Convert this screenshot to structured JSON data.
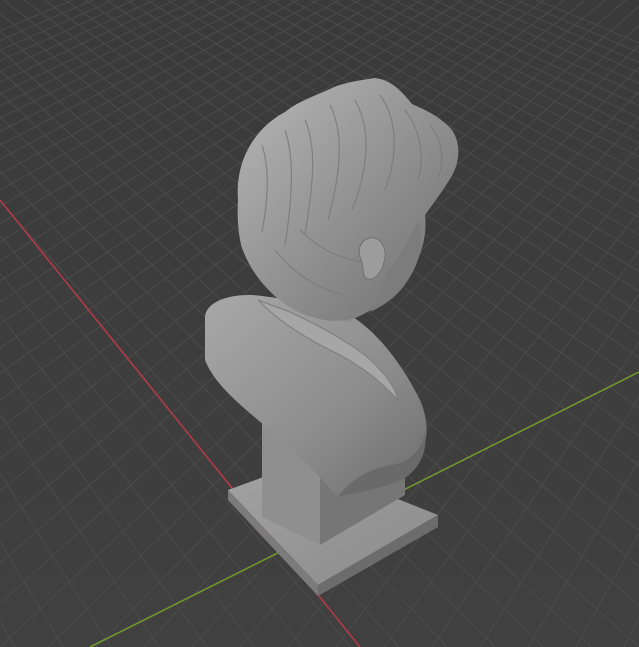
{
  "viewport": {
    "kind": "3d-viewport",
    "background_color": "#3d3d3d",
    "grid_color": "#4b4b4b",
    "x_axis_color": "#b23a48",
    "y_axis_color": "#6f9a2a",
    "object": {
      "type": "sculpted-bust",
      "material_color": "#9a9a9a"
    }
  }
}
